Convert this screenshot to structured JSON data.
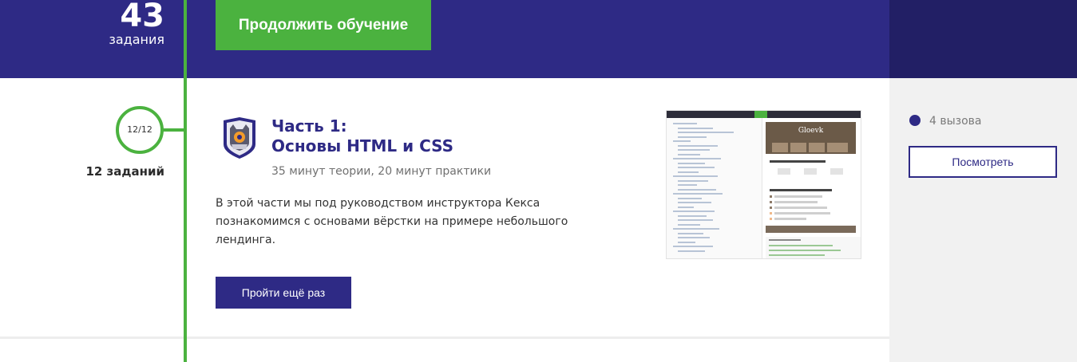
{
  "header": {
    "count": "43",
    "count_label": "задания",
    "continue_button": "Продолжить обучение"
  },
  "lesson": {
    "progress": "12/12",
    "progress_fraction": 1.0,
    "tasks_label": "12 заданий",
    "title_line1": "Часть 1:",
    "title_line2": "Основы HTML и CSS",
    "meta": "35 минут теории, 20 минут практики",
    "description": "В этой части мы под руководством инструктора Кекса познакомимся с основами вёрстки на примере небольшого лендинга.",
    "again_button": "Пройти ещё раз",
    "preview": {
      "site_title": "Gloevk"
    }
  },
  "sidebar": {
    "challenges_label": "4 вызова",
    "view_button": "Посмотреть"
  },
  "colors": {
    "brand_dark": "#2e2a85",
    "accent_green": "#4bb23f",
    "panel_dark": "#221f65"
  },
  "icons": {
    "badge": "htmlacademy-cat-badge-icon",
    "challenge": "challenge-dot-icon"
  }
}
